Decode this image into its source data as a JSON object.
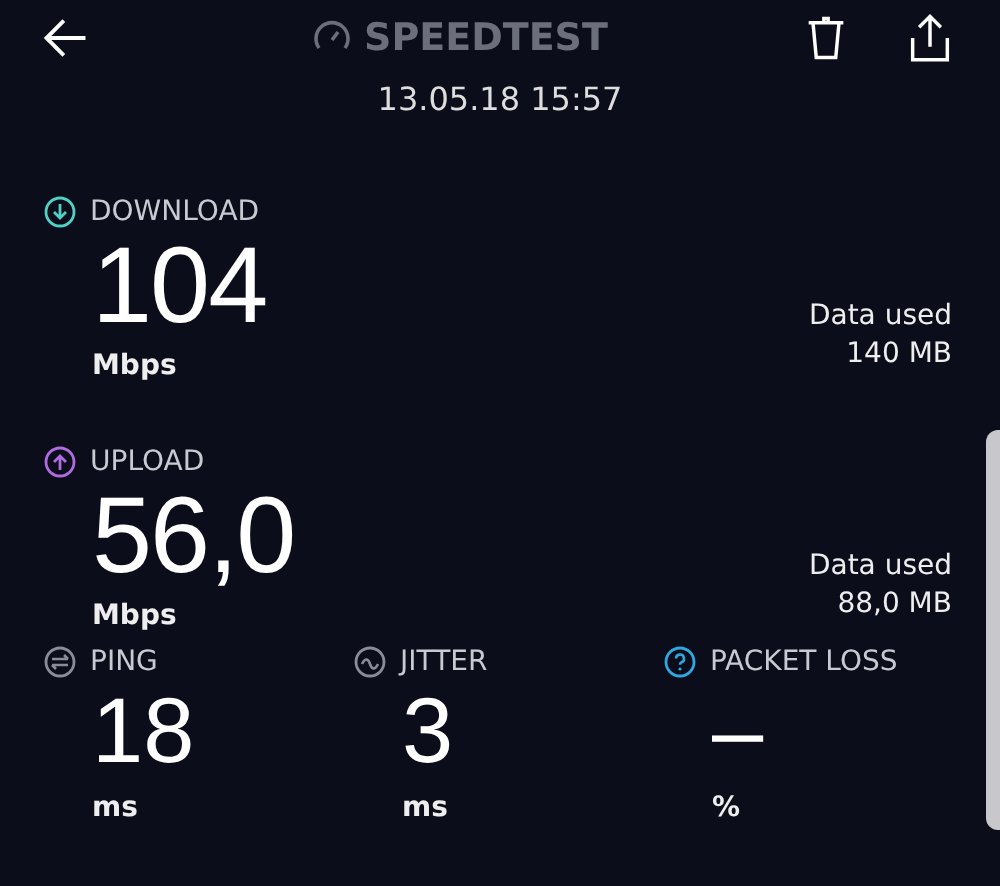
{
  "header": {
    "title": "SPEEDTEST",
    "date": "13.05.18 15:57"
  },
  "speeds": [
    {
      "kind": "download",
      "label": "DOWNLOAD",
      "color": "#4fd1c5",
      "value": "104",
      "unit": "Mbps",
      "data_label": "Data used",
      "data_value": "140 MB"
    },
    {
      "kind": "upload",
      "label": "UPLOAD",
      "color": "#b06be0",
      "value": "56,0",
      "unit": "Mbps",
      "data_label": "Data used",
      "data_value": "88,0 MB"
    }
  ],
  "stats": [
    {
      "kind": "ping",
      "label": "PING",
      "color": "#8a8d99",
      "value": "18",
      "unit": "ms"
    },
    {
      "kind": "jitter",
      "label": "JITTER",
      "color": "#8a8d99",
      "value": "3",
      "unit": "ms"
    },
    {
      "kind": "help",
      "label": "PACKET LOSS",
      "color": "#2fa8e0",
      "value": "–",
      "unit": "%"
    }
  ]
}
